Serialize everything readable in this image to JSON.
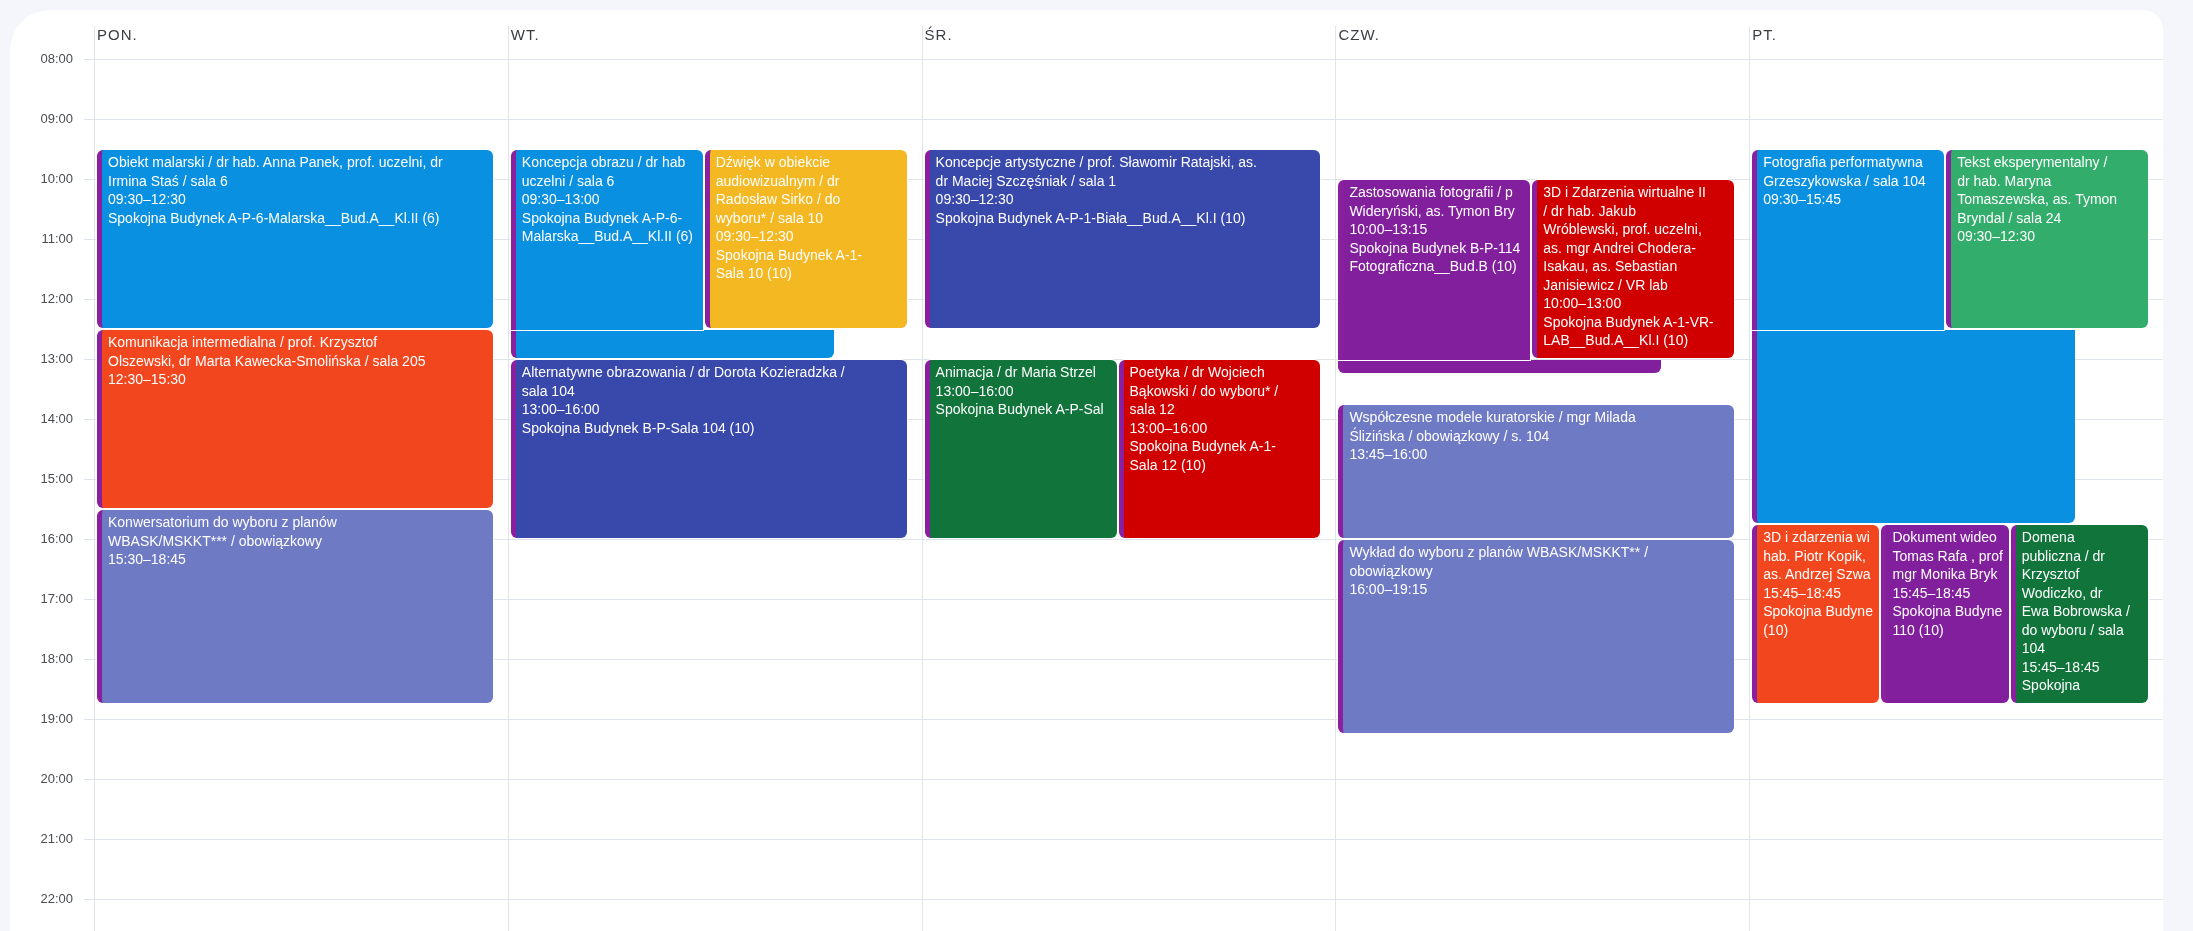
{
  "days": [
    {
      "label": "PON.",
      "events": [
        {
          "title_lines": [
            "Obiekt malarski / dr hab. Anna Panek, prof. uczelni, dr",
            "Irmina Staś / sala 6"
          ],
          "time": "09:30–12:30",
          "location_lines": [
            "Spokojna Budynek A-P-6-Malarska__Bud.A__Kl.II (6)"
          ],
          "color": "#0990e0"
        },
        {
          "title_lines": [
            "Komunikacja intermedialna / prof. Krzysztof",
            "Olszewski, dr Marta Kawecka-Smolińska / sala 205"
          ],
          "time": "12:30–15:30",
          "color": "#f2471e"
        },
        {
          "title_lines": [
            "Konwersatorium do wyboru z planów",
            "WBASK/MSKKT*** / obowiązkowy"
          ],
          "time": "15:30–18:45",
          "color": "#6f7ac4"
        }
      ]
    },
    {
      "label": "WT.",
      "events": [
        {
          "title_lines": [
            "Koncepcja obrazu / dr hab",
            "uczelni / sala 6"
          ],
          "time": "09:30–13:00",
          "location_lines": [
            "Spokojna Budynek A-P-6-",
            "Malarska__Bud.A__Kl.II (6)"
          ],
          "color": "#0990e0"
        },
        {
          "title_lines": [
            "Dźwięk w obiekcie",
            "audiowizualnym / dr",
            "Radosław Sirko / do",
            "wyboru* / sala 10"
          ],
          "time": "09:30–12:30",
          "location_lines": [
            "Spokojna Budynek A-1-",
            "Sala 10 (10)"
          ],
          "color": "#f4b822"
        },
        {
          "title_lines": [
            "Alternatywne obrazowania / dr Dorota Kozieradzka /",
            "sala 104"
          ],
          "time": "13:00–16:00",
          "location_lines": [
            "Spokojna Budynek B-P-Sala 104 (10)"
          ],
          "color": "#3949ab"
        }
      ]
    },
    {
      "label": "ŚR.",
      "events": [
        {
          "title_lines": [
            "Koncepcje artystyczne / prof. Sławomir Ratajski, as.",
            "dr Maciej Szczęśniak / sala 1"
          ],
          "time": "09:30–12:30",
          "location_lines": [
            "Spokojna Budynek A-P-1-Biała__Bud.A__Kl.I (10)"
          ],
          "color": "#3949ab"
        },
        {
          "title_lines": [
            "Animacja / dr Maria Strzel"
          ],
          "time": "13:00–16:00",
          "location_lines": [
            "Spokojna Budynek A-P-Sal"
          ],
          "color": "#10743b"
        },
        {
          "title_lines": [
            "Poetyka / dr Wojciech",
            "Bąkowski / do wyboru* /",
            "sala 12"
          ],
          "time": "13:00–16:00",
          "location_lines": [
            "Spokojna Budynek A-1-",
            "Sala 12 (10)"
          ],
          "color": "#d00000"
        }
      ]
    },
    {
      "label": "CZW.",
      "events": [
        {
          "title_lines": [
            "Zastosowania fotografii / p",
            "Wideryński, as. Tymon Bry"
          ],
          "time": "10:00–13:15",
          "location_lines": [
            "Spokojna Budynek B-P-114",
            "Fotograficzna__Bud.B (10)"
          ],
          "color": "#821f9c"
        },
        {
          "title_lines": [
            "3D i Zdarzenia wirtualne II",
            "/ dr hab. Jakub",
            "Wróblewski, prof. uczelni,",
            "as. mgr Andrei Chodera-",
            "Isakau, as. Sebastian",
            "Janisiewicz / VR lab"
          ],
          "time": "10:00–13:00",
          "location_lines": [
            "Spokojna Budynek A-1-VR-",
            "LAB__Bud.A__Kl.I (10)"
          ],
          "color": "#d00000"
        },
        {
          "title_lines": [
            "Współczesne modele kuratorskie / mgr Milada",
            "Ślizińska / obowiązkowy / s. 104"
          ],
          "time": "13:45–16:00",
          "color": "#6f7ac4"
        },
        {
          "title_lines": [
            "Wykład do wyboru z planów WBASK/MSKKT** /",
            "obowiązkowy"
          ],
          "time": "16:00–19:15",
          "color": "#6f7ac4"
        }
      ]
    },
    {
      "label": "PT.",
      "events": [
        {
          "title_lines": [
            "Fotografia performatywna",
            "Grzeszykowska / sala 104"
          ],
          "time": "09:30–15:45",
          "color": "#0990e0"
        },
        {
          "title_lines": [
            "Tekst eksperymentalny /",
            "dr hab. Maryna",
            "Tomaszewska, as. Tymon",
            "Bryndal / sala 24"
          ],
          "time": "09:30–12:30",
          "color": "#33ad6b"
        },
        {
          "title_lines": [
            "3D i zdarzenia wi",
            "hab. Piotr Kopik,",
            "as. Andrzej Szwa"
          ],
          "time": "15:45–18:45",
          "location_lines": [
            "Spokojna Budyne",
            "(10)"
          ],
          "color": "#f2471e"
        },
        {
          "title_lines": [
            "Dokument wideo",
            "Tomas Rafa , prof",
            "mgr Monika Bryk"
          ],
          "time": "15:45–18:45",
          "location_lines": [
            "Spokojna Budyne",
            "110 (10)"
          ],
          "color": "#821f9c"
        },
        {
          "title_lines": [
            "Domena",
            "publiczna / dr",
            "Krzysztof",
            "Wodiczko, dr",
            "Ewa Bobrowska /",
            "do wyboru / sala",
            "104"
          ],
          "time": "15:45–18:45",
          "location_lines": [
            "Spokojna"
          ],
          "color": "#10743b"
        }
      ]
    }
  ],
  "hours": [
    "08:00",
    "09:00",
    "10:00",
    "11:00",
    "12:00",
    "13:00",
    "14:00",
    "15:00",
    "16:00",
    "17:00",
    "18:00",
    "19:00",
    "20:00",
    "21:00",
    "22:00"
  ]
}
